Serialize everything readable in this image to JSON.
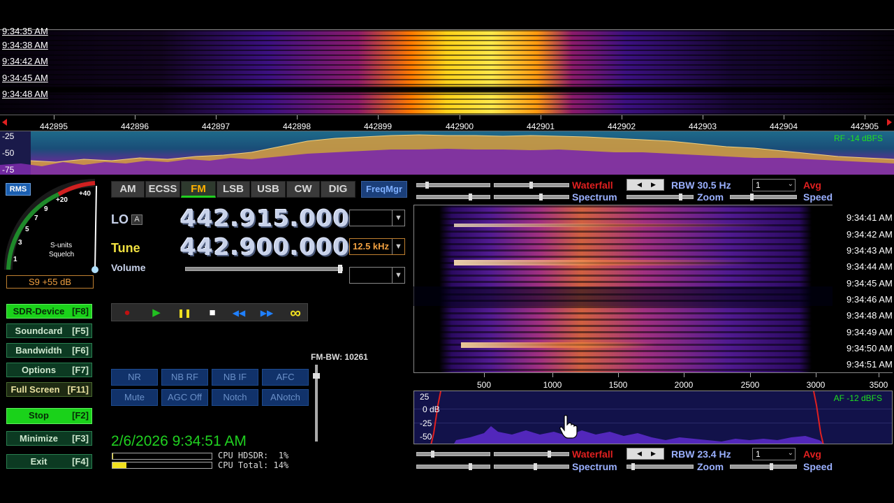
{
  "rf_waterfall": {
    "times": [
      "9:34:35 AM",
      "9:34:38 AM",
      "9:34:42 AM",
      "9:34:45 AM",
      "9:34:48 AM"
    ]
  },
  "freq_axis": {
    "ticks": [
      "442895",
      "442896",
      "442897",
      "442898",
      "442899",
      "442900",
      "442901",
      "442902",
      "442903",
      "442904",
      "442905"
    ]
  },
  "rf_spectrum": {
    "db_labels": [
      "-25",
      "-50",
      "-75"
    ],
    "level": "RF -14 dBFS"
  },
  "meter": {
    "rms_label": "RMS",
    "scale": [
      "1",
      "3",
      "5",
      "7",
      "9",
      "+20",
      "+40"
    ],
    "caption_line1": "S-units",
    "caption_line2": "Squelch",
    "readout": "S9 +55 dB"
  },
  "side_buttons": [
    {
      "label": "SDR-Device",
      "key": "[F8]"
    },
    {
      "label": "Soundcard",
      "key": "[F5]"
    },
    {
      "label": "Bandwidth",
      "key": "[F6]"
    },
    {
      "label": "Options",
      "key": "[F7]"
    },
    {
      "label": "Full Screen",
      "key": "[F11]"
    },
    {
      "label": "Stop",
      "key": "[F2]"
    },
    {
      "label": "Minimize",
      "key": "[F3]"
    },
    {
      "label": "Exit",
      "key": "[F4]"
    }
  ],
  "modes": [
    "AM",
    "ECSS",
    "FM",
    "LSB",
    "USB",
    "CW",
    "DIG"
  ],
  "active_mode": "FM",
  "freqmgr_label": "FreqMgr",
  "lo": {
    "label": "LO",
    "badge": "A",
    "freq": "442.915.000"
  },
  "tune": {
    "label": "Tune",
    "freq": "442.900.000",
    "step": "12.5 kHz"
  },
  "volume_label": "Volume",
  "transport": {
    "record": "●",
    "play": "▶",
    "pause": "❚❚",
    "stop": "■",
    "rewind": "◀◀",
    "forward": "▶▶",
    "loop": "∞"
  },
  "dsp_buttons": [
    [
      "NR",
      "NB RF",
      "NB IF",
      "AFC"
    ],
    [
      "Mute",
      "AGC Off",
      "Notch",
      "ANotch"
    ]
  ],
  "fm_bw": "FM-BW: 10261",
  "datetime": "2/6/2026 9:34:51 AM",
  "cpu": {
    "hdsdr": "CPU HDSDR:  1%",
    "total": "CPU Total: 14%",
    "hdsdr_fraction": 0.01,
    "total_fraction": 0.14
  },
  "af_controls_top": {
    "waterfall": "Waterfall",
    "spectrum": "Spectrum",
    "rbw": "RBW 30.5 Hz",
    "zoom": "Zoom",
    "avg_value": "1",
    "avg": "Avg",
    "speed": "Speed"
  },
  "af_controls_bottom": {
    "waterfall": "Waterfall",
    "spectrum": "Spectrum",
    "rbw": "RBW 23.4 Hz",
    "zoom": "Zoom",
    "avg_value": "1",
    "avg": "Avg",
    "speed": "Speed"
  },
  "af_waterfall": {
    "times": [
      "9:34:41 AM",
      "9:34:42 AM",
      "9:34:43 AM",
      "9:34:44 AM",
      "9:34:45 AM",
      "9:34:46 AM",
      "9:34:48 AM",
      "9:34:49 AM",
      "9:34:50 AM",
      "9:34:51 AM"
    ]
  },
  "af_axis": {
    "ticks": [
      "500",
      "1000",
      "1500",
      "2000",
      "2500",
      "3000",
      "3500"
    ]
  },
  "af_spectrum": {
    "db_labels": [
      "25",
      "0 dB",
      "-25",
      "-50"
    ],
    "level": "AF -12 dBFS"
  },
  "colors": {
    "accent_green": "#20d020",
    "waterfall_red": "#e02020",
    "mode_active": "#ffb000"
  }
}
